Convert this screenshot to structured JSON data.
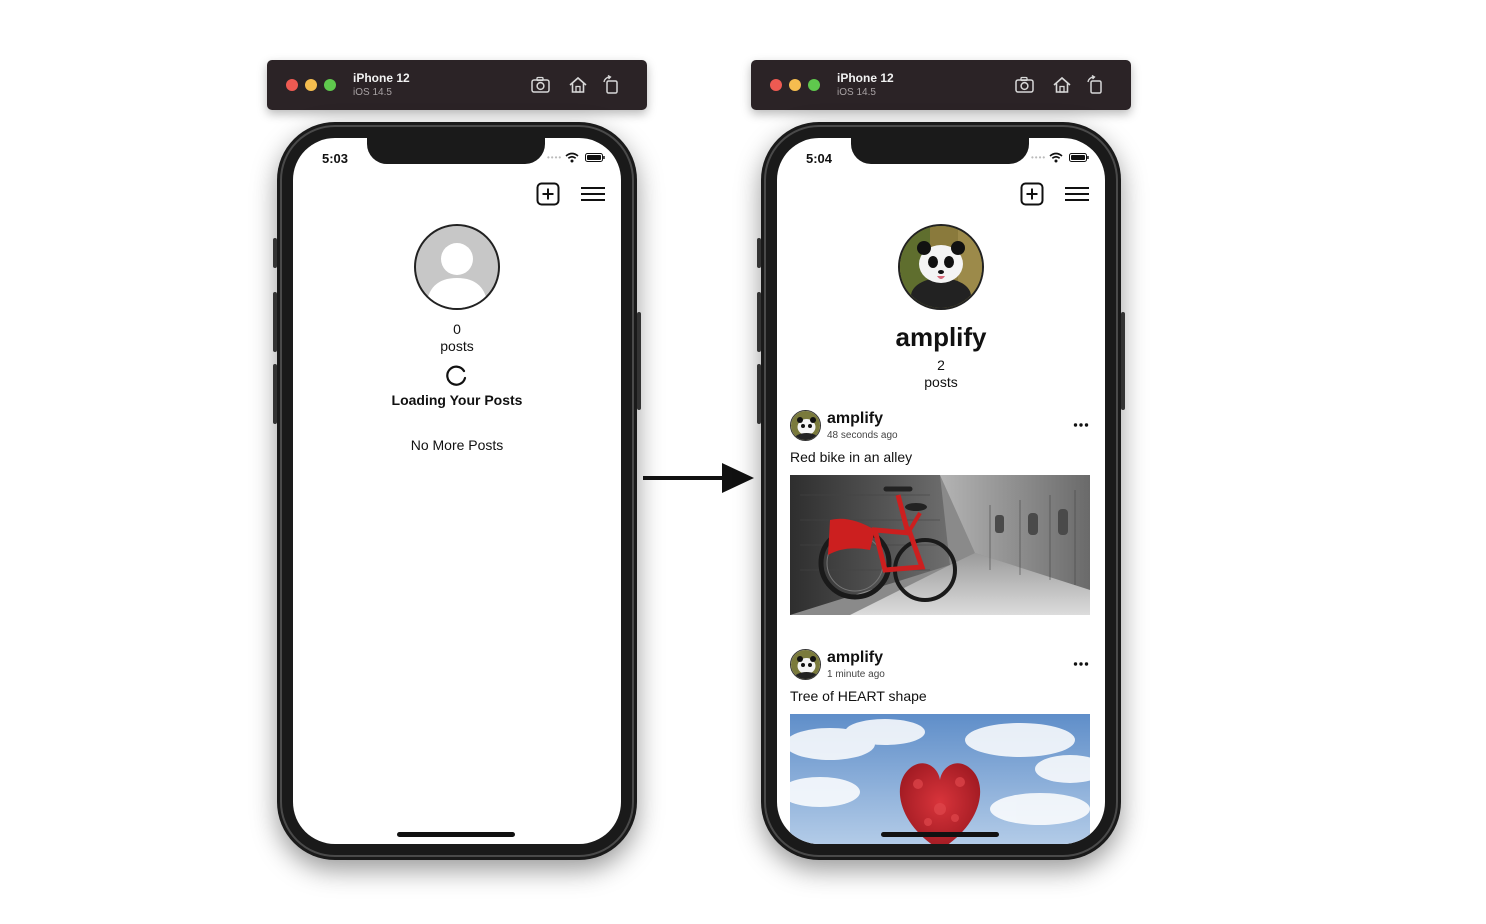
{
  "left_simulator": {
    "device_name": "iPhone 12",
    "os_version": "iOS 14.5",
    "status_time": "5:03",
    "profile": {
      "post_count": "0",
      "posts_label": "posts",
      "loading_text": "Loading Your Posts",
      "no_more_text": "No More Posts"
    }
  },
  "right_simulator": {
    "device_name": "iPhone 12",
    "os_version": "iOS 14.5",
    "status_time": "5:04",
    "profile": {
      "username": "amplify",
      "post_count": "2",
      "posts_label": "posts"
    },
    "posts": [
      {
        "author": "amplify",
        "time": "48 seconds ago",
        "caption": "Red bike in an alley",
        "image_icon": "red-bike-photo"
      },
      {
        "author": "amplify",
        "time": "1 minute ago",
        "caption": "Tree of HEART shape",
        "image_icon": "heart-tree-photo"
      }
    ]
  },
  "icons": {
    "screenshot": "camera-icon",
    "home": "home-icon",
    "rotate": "rotate-icon",
    "add_post": "plus-square-icon",
    "menu": "hamburger-menu-icon",
    "more": "ellipsis-icon",
    "transition": "right-arrow-icon"
  },
  "colors": {
    "titlebar": "#2b2326",
    "traffic_red": "#ee5a52",
    "traffic_yellow": "#f5bd4f",
    "traffic_green": "#5fc84d",
    "bike_red": "#cc1f1f",
    "heart_red": "#c21f26"
  }
}
